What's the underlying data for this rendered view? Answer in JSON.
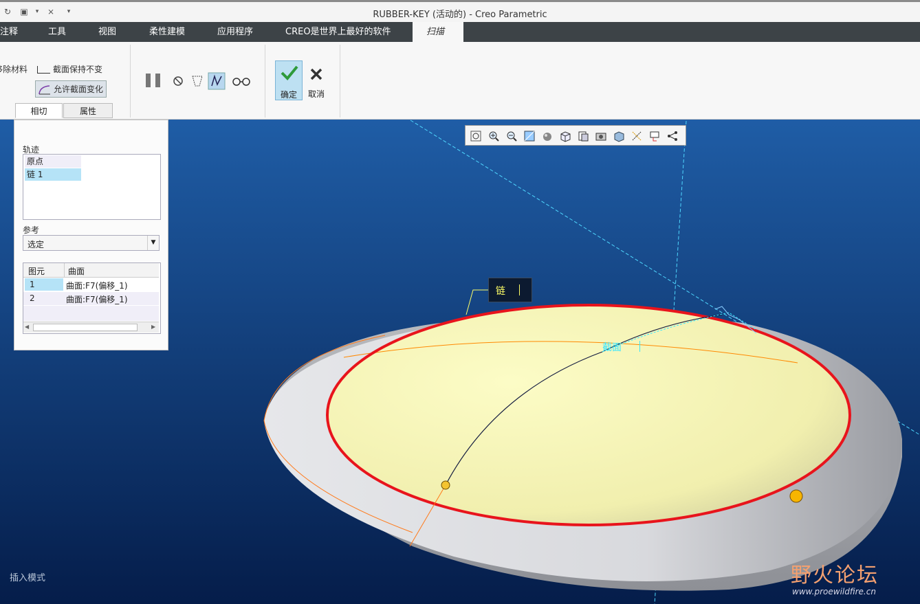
{
  "window": {
    "title": "RUBBER-KEY (活动的) - Creo Parametric"
  },
  "tabs": [
    {
      "label": "注释"
    },
    {
      "label": "工具"
    },
    {
      "label": "视图"
    },
    {
      "label": "柔性建模"
    },
    {
      "label": "应用程序"
    },
    {
      "label": "CREO是世界上最好的软件"
    },
    {
      "label": "扫描"
    }
  ],
  "ribbon": {
    "remove_material": "移除材料",
    "constant_section": "截面保持不变",
    "variable_section": "允许截面变化",
    "ok": "确定",
    "cancel": "取消",
    "subtabs": [
      "相切",
      "属性"
    ]
  },
  "panel": {
    "trajectory_label": "轨迹",
    "trajectories": [
      "原点",
      "链 1"
    ],
    "reference_label": "参考",
    "reference_select": "选定",
    "table_headers": [
      "图元",
      "曲面"
    ],
    "rows": [
      {
        "id": "1",
        "surface": "曲面:F7(偏移_1)"
      },
      {
        "id": "2",
        "surface": "曲面:F7(偏移_1)"
      }
    ]
  },
  "viewport": {
    "chain_label": "链",
    "section_label": "截面",
    "mode": "插入模式",
    "watermark_title": "野火论坛",
    "watermark_url": "www.proewildfire.cn"
  },
  "colors": {
    "background_top": "#1f5da6",
    "background_bottom": "#051d4a",
    "highlight": "#e8141c",
    "surface": "#f7f5b0",
    "tab_bar": "#3d4347",
    "cyan": "#36e6ff"
  }
}
